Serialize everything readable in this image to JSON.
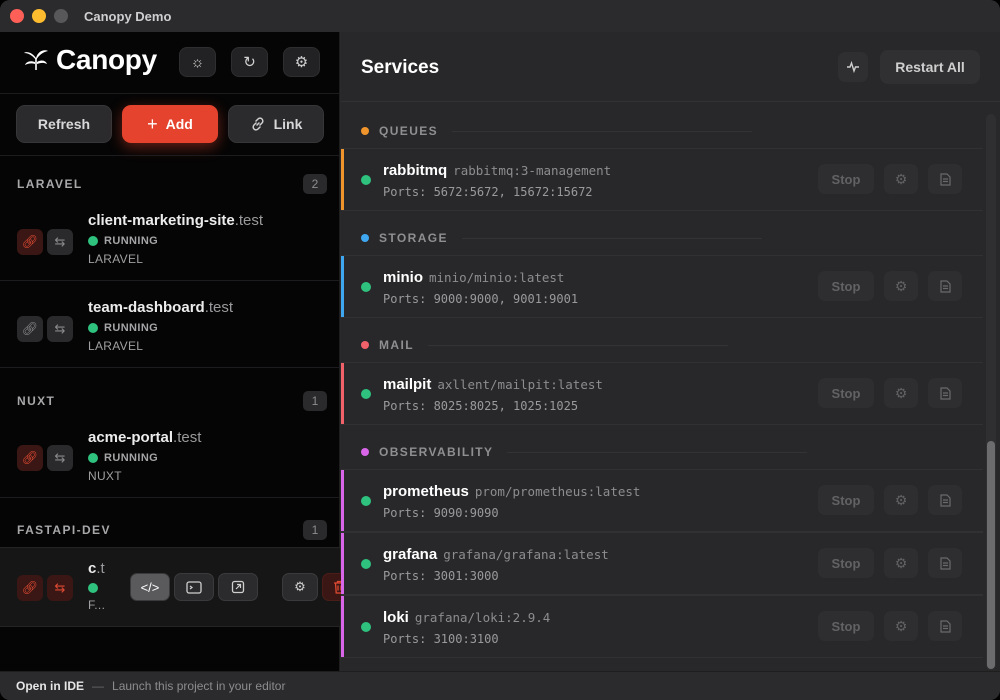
{
  "window": {
    "title": "Canopy Demo"
  },
  "brand": {
    "name": "Canopy"
  },
  "sidebar": {
    "actions": {
      "refresh": "Refresh",
      "add": "Add",
      "link": "Link"
    },
    "groups": [
      {
        "name": "LARAVEL",
        "count": "2"
      },
      {
        "name": "NUXT",
        "count": "1"
      },
      {
        "name": "FASTAPI-DEV",
        "count": "1"
      }
    ],
    "sites": [
      {
        "name": "client-marketing-site",
        "tld": ".test",
        "status": "RUNNING",
        "framework": "LARAVEL"
      },
      {
        "name": "team-dashboard",
        "tld": ".test",
        "status": "RUNNING",
        "framework": "LARAVEL"
      },
      {
        "name": "acme-portal",
        "tld": ".test",
        "status": "RUNNING",
        "framework": "NUXT"
      },
      {
        "name": "c",
        "tld": ".t",
        "status": "",
        "framework": "F..."
      }
    ]
  },
  "main": {
    "title": "Services",
    "restart_all": "Restart All",
    "categories": [
      {
        "name": "QUEUES",
        "color": "#f0952c"
      },
      {
        "name": "STORAGE",
        "color": "#3fa7f0"
      },
      {
        "name": "MAIL",
        "color": "#f0616a"
      },
      {
        "name": "OBSERVABILITY",
        "color": "#d966e8"
      }
    ],
    "services": [
      {
        "name": "rabbitmq",
        "image": "rabbitmq:3-management",
        "ports": "Ports: 5672:5672, 15672:15672",
        "stop": "Stop"
      },
      {
        "name": "minio",
        "image": "minio/minio:latest",
        "ports": "Ports: 9000:9000, 9001:9001",
        "stop": "Stop"
      },
      {
        "name": "mailpit",
        "image": "axllent/mailpit:latest",
        "ports": "Ports: 8025:8025, 1025:1025",
        "stop": "Stop"
      },
      {
        "name": "prometheus",
        "image": "prom/prometheus:latest",
        "ports": "Ports: 9090:9090",
        "stop": "Stop"
      },
      {
        "name": "grafana",
        "image": "grafana/grafana:latest",
        "ports": "Ports: 3001:3000",
        "stop": "Stop"
      },
      {
        "name": "loki",
        "image": "grafana/loki:2.9.4",
        "ports": "Ports: 3100:3100",
        "stop": "Stop"
      }
    ]
  },
  "statusbar": {
    "key": "Open in IDE",
    "sep": "—",
    "hint": "Launch this project in your editor"
  },
  "colors": {
    "accent": "#e5432d",
    "running": "#2ec27e"
  }
}
